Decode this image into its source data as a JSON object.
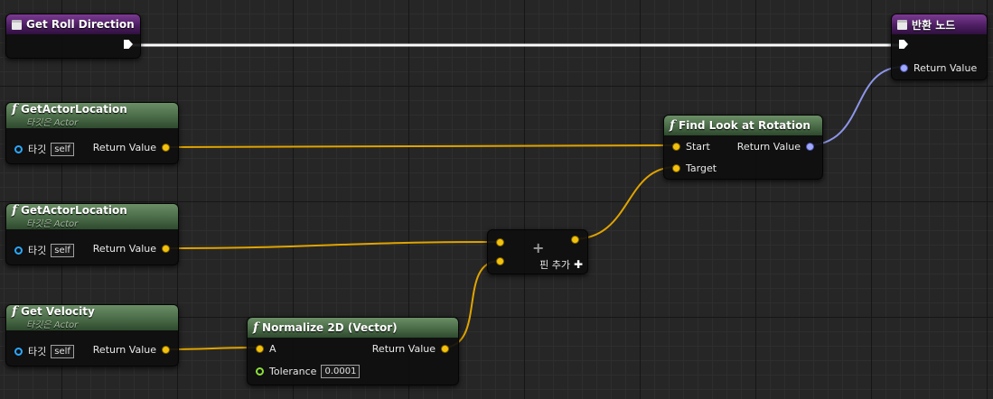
{
  "nodes": {
    "entry": {
      "title": "Get Roll Direction"
    },
    "return_node": {
      "title": "반환 노드",
      "pin_return": "Return Value"
    },
    "get_actor_location_1": {
      "title": "GetActorLocation",
      "subtitle": "타깃은 Actor",
      "pin_target": "타깃",
      "target_value": "self",
      "pin_return": "Return Value"
    },
    "get_actor_location_2": {
      "title": "GetActorLocation",
      "subtitle": "타깃은 Actor",
      "pin_target": "타깃",
      "target_value": "self",
      "pin_return": "Return Value"
    },
    "get_velocity": {
      "title": "Get Velocity",
      "subtitle": "타깃은 Actor",
      "pin_target": "타깃",
      "target_value": "self",
      "pin_return": "Return Value"
    },
    "find_look_at_rotation": {
      "title": "Find Look at Rotation",
      "pin_start": "Start",
      "pin_target": "Target",
      "pin_return": "Return Value"
    },
    "normalize_2d": {
      "title": "Normalize 2D (Vector)",
      "pin_a": "A",
      "pin_tolerance": "Tolerance",
      "tolerance_value": "0.0001",
      "pin_return": "Return Value"
    },
    "add_node": {
      "symbol": "+",
      "add_pin_label": "핀 추가"
    }
  },
  "colors": {
    "vector_pin": "#f4c20d",
    "rotator_pin": "#a0a8ff",
    "object_pin": "#2aa8ff",
    "float_pin": "#8ce03a",
    "exec_wire": "#ffffff",
    "function_header": "#4a6b47",
    "event_header": "#4e1f63"
  }
}
